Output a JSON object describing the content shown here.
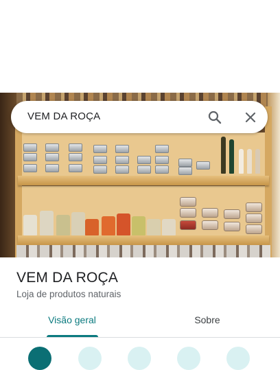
{
  "search": {
    "query": "VEM DA ROÇA",
    "search_icon": "search-icon",
    "close_icon": "close-icon"
  },
  "photo": {
    "description_icon": "store-photo"
  },
  "place": {
    "name": "VEM DA ROÇA",
    "category": "Loja de produtos naturais"
  },
  "tabs": [
    {
      "label": "Visão geral",
      "selected": true
    },
    {
      "label": "Sobre",
      "selected": false
    }
  ],
  "colors": {
    "accent": "#0b7a7f",
    "text_primary": "#202124",
    "text_secondary": "#5f6368"
  }
}
